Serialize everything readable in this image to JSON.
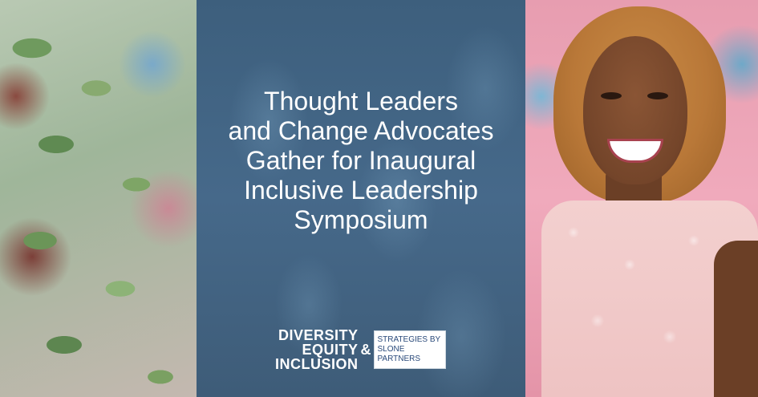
{
  "headline": {
    "lines": [
      "Thought Leaders",
      "and Change Advocates",
      "Gather for Inaugural",
      "Inclusive Leadership",
      "Symposium"
    ]
  },
  "logo": {
    "words": [
      "DIVERSITY",
      "EQUITY",
      "INCLUSION"
    ],
    "ampersand": "&",
    "box_lines": [
      "STRATEGIES BY",
      "SLONE PARTNERS"
    ]
  },
  "colors": {
    "panel": "#46698a",
    "text": "#ffffff",
    "logo_box_text": "#2a4a7a"
  }
}
